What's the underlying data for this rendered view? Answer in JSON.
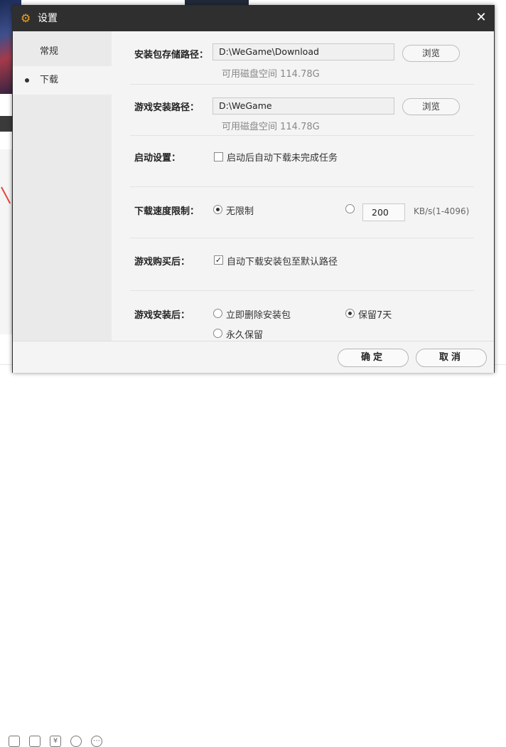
{
  "dialog": {
    "title": "设置",
    "title_icon": "gear-icon",
    "close_symbol": "✕"
  },
  "sidebar": {
    "items": [
      {
        "label": "常规",
        "active": false
      },
      {
        "label": "下载",
        "active": true
      }
    ]
  },
  "settings": {
    "package_path": {
      "label": "安装包存储路径：",
      "value": "D:\\WeGame\\Download",
      "browse_label": "浏览",
      "free_space": "可用磁盘空间 114.78G"
    },
    "install_path": {
      "label": "游戏安装路径：",
      "value": "D:\\WeGame",
      "browse_label": "浏览",
      "free_space": "可用磁盘空间 114.78G"
    },
    "startup": {
      "label": "启动设置：",
      "option": "启动后自动下载未完成任务",
      "checked": false
    },
    "speed_limit": {
      "label": "下载速度限制：",
      "unlimited_label": "无限制",
      "unlimited_selected": true,
      "limit_value": "200",
      "unit": "KB/s(1-4096)"
    },
    "after_purchase": {
      "label": "游戏购买后：",
      "option": "自动下载安装包至默认路径",
      "checked": true
    },
    "after_install": {
      "label": "游戏安装后：",
      "options": [
        {
          "label": "立即删除安装包",
          "selected": false
        },
        {
          "label": "保留7天",
          "selected": true
        },
        {
          "label": "永久保留",
          "selected": false
        }
      ]
    }
  },
  "footer": {
    "confirm_label": "确定",
    "cancel_label": "取消"
  },
  "colors": {
    "titlebar": "#2f2f2f",
    "accent_icon": "#f0a020",
    "panel": "#f4f4f4",
    "sidebar": "#eaeaea"
  }
}
